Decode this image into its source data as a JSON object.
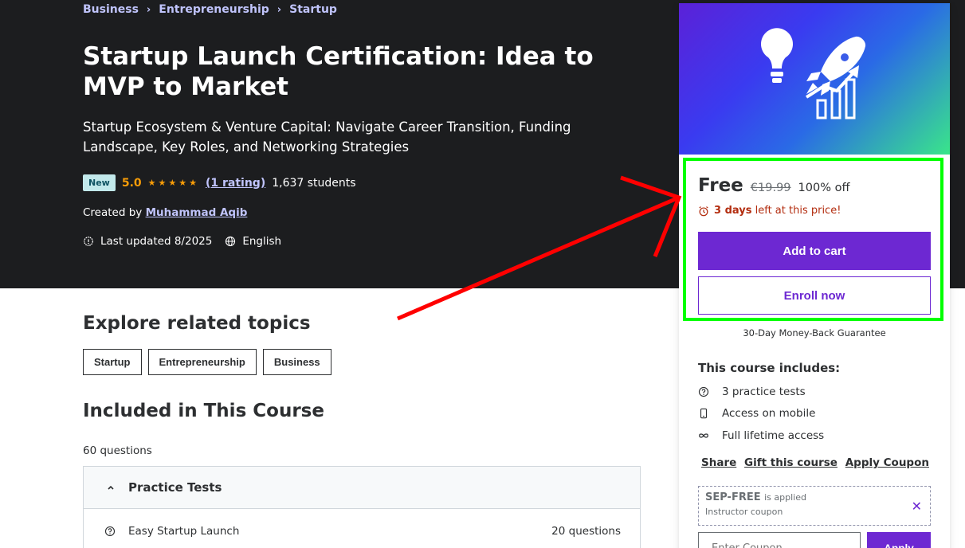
{
  "breadcrumb": [
    "Business",
    "Entrepreneurship",
    "Startup"
  ],
  "course": {
    "title": "Startup Launch Certification: Idea to MVP to Market",
    "subtitle": "Startup Ecosystem & Venture Capital: Navigate Career Transition, Funding Landscape, Key Roles, and Networking Strategies",
    "badge": "New",
    "rating": "5.0",
    "stars": "★★★★★",
    "rating_count": "(1 rating)",
    "students": "1,637 students",
    "created_by_label": "Created by",
    "instructor": "Muhammad Aqib",
    "last_updated": "Last updated 8/2025",
    "language": "English"
  },
  "related": {
    "heading": "Explore related topics",
    "topics": [
      "Startup",
      "Entrepreneurship",
      "Business"
    ]
  },
  "included": {
    "heading": "Included in This Course",
    "questions": "60 questions",
    "section_title": "Practice Tests",
    "rows": [
      {
        "label": "Easy Startup Launch",
        "count": "20 questions"
      }
    ]
  },
  "sidebar": {
    "price": "Free",
    "original_price": "€19.99",
    "discount": "100% off",
    "timer_bold": "3 days",
    "timer_rest": "left at this price!",
    "add_to_cart": "Add to cart",
    "enroll_now": "Enroll now",
    "guarantee": "30-Day Money-Back Guarantee",
    "includes_heading": "This course includes:",
    "includes": [
      {
        "icon": "question-circle-icon",
        "label": "3 practice tests"
      },
      {
        "icon": "mobile-icon",
        "label": "Access on mobile"
      },
      {
        "icon": "infinity-icon",
        "label": "Full lifetime access"
      }
    ],
    "links": [
      "Share",
      "Gift this course",
      "Apply Coupon"
    ],
    "coupon": {
      "code": "SEP-FREE",
      "applied": "is applied",
      "type": "Instructor coupon"
    },
    "coupon_placeholder": "Enter Coupon",
    "apply": "Apply"
  },
  "colors": {
    "accent": "#6d28d2",
    "hero_bg": "#1c1d1f",
    "link": "#c0c4fc",
    "star": "#f69c08",
    "annotation_green": "#00ff00",
    "annotation_red": "#ff0000"
  }
}
